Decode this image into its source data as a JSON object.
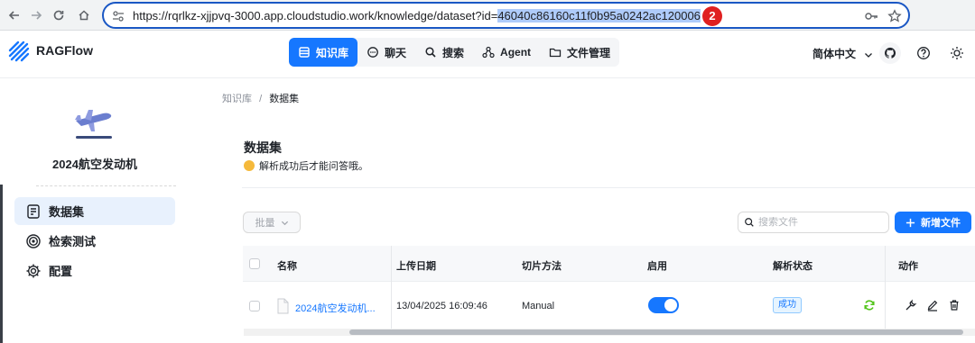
{
  "browser": {
    "url_prefix": "https://rqrlkz-xjjpvq-3000.app.cloudstudio.work/knowledge/dataset?id=",
    "url_id": "46040c86160c11f0b95a0242ac120006",
    "badge": "2"
  },
  "header": {
    "brand": "RAGFlow",
    "nav": [
      {
        "label": "知识库",
        "icon": "database-icon",
        "active": true
      },
      {
        "label": "聊天",
        "icon": "chat-icon",
        "active": false
      },
      {
        "label": "搜索",
        "icon": "search-icon",
        "active": false
      },
      {
        "label": "Agent",
        "icon": "agent-icon",
        "active": false
      },
      {
        "label": "文件管理",
        "icon": "folder-icon",
        "active": false
      }
    ],
    "language": "简体中文"
  },
  "sidebar": {
    "kb_name": "2024航空发动机",
    "items": [
      {
        "label": "数据集",
        "icon": "document-icon",
        "active": true
      },
      {
        "label": "检索测试",
        "icon": "target-icon",
        "active": false
      },
      {
        "label": "配置",
        "icon": "gear-icon",
        "active": false
      }
    ]
  },
  "breadcrumb": {
    "parent": "知识库",
    "separator": "/",
    "current": "数据集"
  },
  "page": {
    "title": "数据集",
    "subtitle": "解析成功后才能问答哦。"
  },
  "toolbar": {
    "bulk_label": "批量",
    "search_placeholder": "搜索文件",
    "add_label": "新增文件"
  },
  "table": {
    "columns": [
      "名称",
      "上传日期",
      "切片方法",
      "启用",
      "解析状态",
      "动作"
    ],
    "rows": [
      {
        "name": "2024航空发动机...",
        "upload_date": "13/04/2025 16:09:46",
        "chunk_method": "Manual",
        "enabled": true,
        "status": "成功"
      }
    ]
  },
  "colors": {
    "accent": "#1677ff",
    "badge": "#e02020",
    "success": "#52c41a"
  }
}
